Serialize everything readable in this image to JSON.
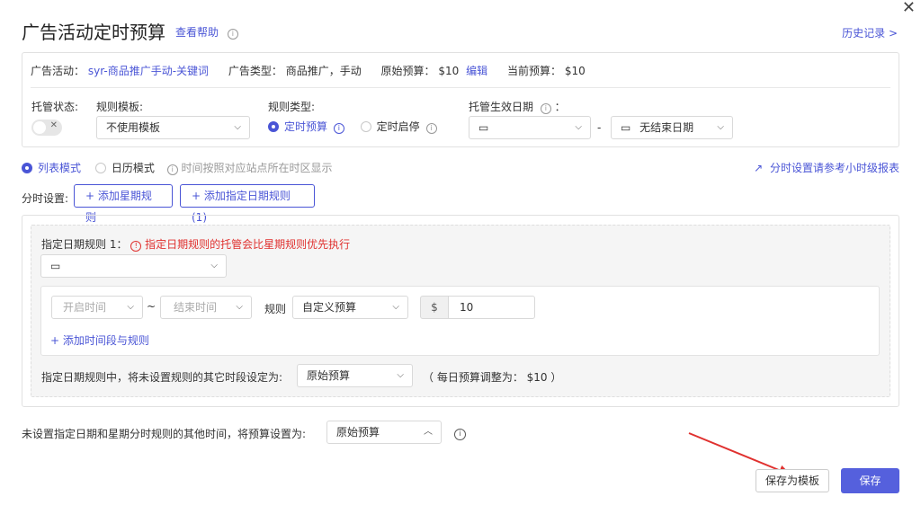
{
  "header": {
    "title": "广告活动定时预算",
    "help_link": "查看帮助",
    "history_link": "历史记录 >"
  },
  "campaign_info": {
    "campaign_label": "广告活动：",
    "campaign_name": "syr-商品推广手动-关键词",
    "ad_type_label": "广告类型：",
    "ad_type_value": "商品推广，手动",
    "original_budget_label": "原始预算：",
    "original_budget_value": "$10",
    "edit_link": "编辑",
    "current_budget_label": "当前预算：",
    "current_budget_value": "$10"
  },
  "settings": {
    "managed_status_label": "托管状态:",
    "rule_template_label": "规则模板:",
    "rule_template_value": "不使用模板",
    "rule_type_label": "规则类型:",
    "rule_type_options": [
      "定时预算",
      "定时启停"
    ],
    "effective_date_label": "托管生效日期",
    "date_separator": "-",
    "end_date_value": "无结束日期"
  },
  "modes": {
    "list_mode": "列表模式",
    "calendar_mode": "日历模式",
    "timezone_note": "时间按照对应站点所在时区显示",
    "report_link": "分时设置请参考小时级报表"
  },
  "period": {
    "label": "分时设置:",
    "add_week_rule": "添加星期规则",
    "add_date_rule": "添加指定日期规则 (1)"
  },
  "date_rule": {
    "title": "指定日期规则 1：",
    "warning": "指定日期规则的托管会比星期规则优先执行",
    "start_time_placeholder": "开启时间",
    "tilde": "~",
    "end_time_placeholder": "结束时间",
    "rule_label": "规则",
    "rule_value": "自定义预算",
    "currency": "$",
    "amount": "10",
    "add_slot": "添加时间段与规则",
    "other_time_label": "指定日期规则中，将未设置规则的其它时段设定为:",
    "other_time_value": "原始预算",
    "daily_note": "（ 每日预算调整为： $10 ）"
  },
  "footer": {
    "other_label": "未设置指定日期和星期分时规则的其他时间，将预算设置为:",
    "other_value": "原始预算",
    "save_template": "保存为模板",
    "save": "保存"
  },
  "colors": {
    "accent": "#4a55d6",
    "warning": "#e0312f",
    "arrow": "#e0312f"
  }
}
